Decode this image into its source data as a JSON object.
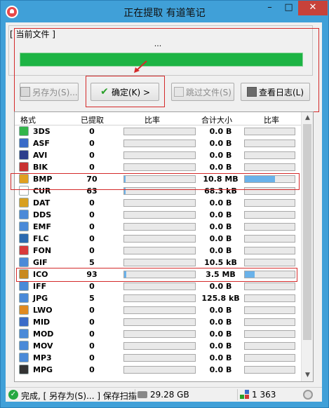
{
  "window": {
    "title": "正在提取 有道笔记",
    "minimize": "–",
    "maximize": "□",
    "close": "✕"
  },
  "current_file": {
    "label": "[ 当前文件 ]",
    "name": "...",
    "progress": 1.0
  },
  "buttons": {
    "save_as": "另存为(S)...",
    "ok": "确定(K) >",
    "skip": "跳过文件(S)",
    "view_log": "查看日志(L)"
  },
  "table": {
    "headers": [
      "格式",
      "已提取",
      "比率",
      "合计大小",
      "比率"
    ],
    "rows": [
      {
        "name": "3DS",
        "count": "0",
        "size": "0.0 B",
        "r1": 0,
        "r2": 0,
        "icon": "3ds-icon",
        "color": "#33b54a"
      },
      {
        "name": "ASF",
        "count": "0",
        "size": "0.0 B",
        "r1": 0,
        "r2": 0,
        "icon": "asf-icon",
        "color": "#3a6cc8"
      },
      {
        "name": "AVI",
        "count": "0",
        "size": "0.0 B",
        "r1": 0,
        "r2": 0,
        "icon": "avi-icon",
        "color": "#2b3f8c"
      },
      {
        "name": "BIK",
        "count": "0",
        "size": "0.0 B",
        "r1": 0,
        "r2": 0,
        "icon": "bik-icon",
        "color": "#c83232"
      },
      {
        "name": "BMP",
        "count": "70",
        "size": "10.8 MB",
        "r1": 0.02,
        "r2": 0.6,
        "icon": "bmp-icon",
        "color": "#e0a020"
      },
      {
        "name": "CUR",
        "count": "63",
        "size": "68.3 kB",
        "r1": 0.02,
        "r2": 0,
        "icon": "cur-icon",
        "color": "#ffffff"
      },
      {
        "name": "DAT",
        "count": "0",
        "size": "0.0 B",
        "r1": 0,
        "r2": 0,
        "icon": "dat-icon",
        "color": "#d8a020"
      },
      {
        "name": "DDS",
        "count": "0",
        "size": "0.0 B",
        "r1": 0,
        "r2": 0,
        "icon": "dds-icon",
        "color": "#4a8ad8"
      },
      {
        "name": "EMF",
        "count": "0",
        "size": "0.0 B",
        "r1": 0,
        "r2": 0,
        "icon": "emf-icon",
        "color": "#4a8ad8"
      },
      {
        "name": "FLC",
        "count": "0",
        "size": "0.0 B",
        "r1": 0,
        "r2": 0,
        "icon": "flc-icon",
        "color": "#2a6ab0"
      },
      {
        "name": "FON",
        "count": "0",
        "size": "0.0 B",
        "r1": 0,
        "r2": 0,
        "icon": "fon-icon",
        "color": "#d83a3a"
      },
      {
        "name": "GIF",
        "count": "5",
        "size": "10.5 kB",
        "r1": 0,
        "r2": 0,
        "icon": "gif-icon",
        "color": "#4a8ad8"
      },
      {
        "name": "ICO",
        "count": "93",
        "size": "3.5 MB",
        "r1": 0.03,
        "r2": 0.2,
        "icon": "ico-icon",
        "color": "#c88a20"
      },
      {
        "name": "IFF",
        "count": "0",
        "size": "0.0 B",
        "r1": 0,
        "r2": 0,
        "icon": "iff-icon",
        "color": "#4a8ad8"
      },
      {
        "name": "JPG",
        "count": "5",
        "size": "125.8 kB",
        "r1": 0,
        "r2": 0,
        "icon": "jpg-icon",
        "color": "#4a8ad8"
      },
      {
        "name": "LWO",
        "count": "0",
        "size": "0.0 B",
        "r1": 0,
        "r2": 0,
        "icon": "lwo-icon",
        "color": "#e08a20"
      },
      {
        "name": "MID",
        "count": "0",
        "size": "0.0 B",
        "r1": 0,
        "r2": 0,
        "icon": "mid-icon",
        "color": "#3a6cc8"
      },
      {
        "name": "MOD",
        "count": "0",
        "size": "0.0 B",
        "r1": 0,
        "r2": 0,
        "icon": "mod-icon",
        "color": "#4a8ad8"
      },
      {
        "name": "MOV",
        "count": "0",
        "size": "0.0 B",
        "r1": 0,
        "r2": 0,
        "icon": "mov-icon",
        "color": "#4a8ad8"
      },
      {
        "name": "MP3",
        "count": "0",
        "size": "0.0 B",
        "r1": 0,
        "r2": 0,
        "icon": "mp3-icon",
        "color": "#4a8ad8"
      },
      {
        "name": "MPG",
        "count": "0",
        "size": "0.0 B",
        "r1": 0,
        "r2": 0,
        "icon": "mpg-icon",
        "color": "#333333"
      }
    ]
  },
  "status": {
    "main": "完成, [ 另存为(S)... ] 保存扫描",
    "disk": "29.28 GB",
    "count": "1 363"
  }
}
